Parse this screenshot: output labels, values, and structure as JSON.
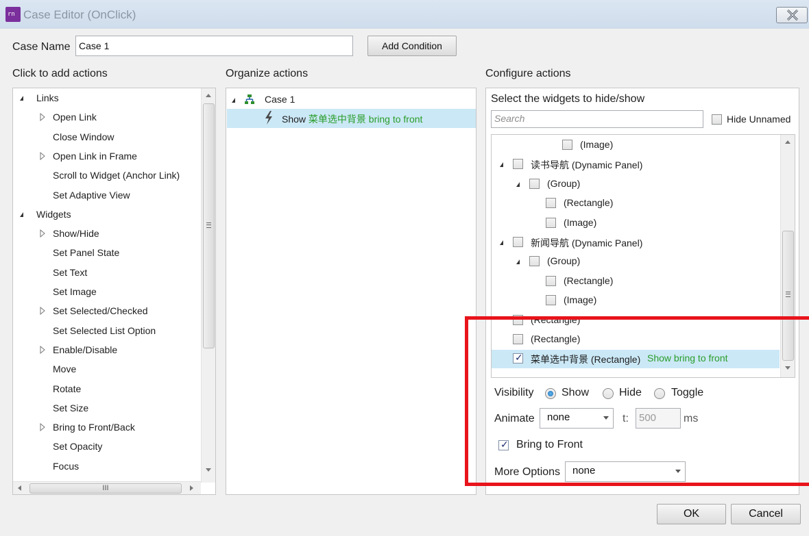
{
  "window": {
    "title": "Case Editor (OnClick)",
    "close_icon": "close-icon"
  },
  "case_name": {
    "label": "Case Name",
    "value": "Case 1",
    "add_condition": "Add Condition"
  },
  "left": {
    "heading": "Click to add actions",
    "items": [
      {
        "label": "Links",
        "level": 0,
        "exp": "open"
      },
      {
        "label": "Open Link",
        "level": 1,
        "exp": "closed"
      },
      {
        "label": "Close Window",
        "level": 1,
        "exp": "none"
      },
      {
        "label": "Open Link in Frame",
        "level": 1,
        "exp": "closed"
      },
      {
        "label": "Scroll to Widget (Anchor Link)",
        "level": 1,
        "exp": "none"
      },
      {
        "label": "Set Adaptive View",
        "level": 1,
        "exp": "none"
      },
      {
        "label": "Widgets",
        "level": 0,
        "exp": "open"
      },
      {
        "label": "Show/Hide",
        "level": 1,
        "exp": "closed"
      },
      {
        "label": "Set Panel State",
        "level": 1,
        "exp": "none"
      },
      {
        "label": "Set Text",
        "level": 1,
        "exp": "none"
      },
      {
        "label": "Set Image",
        "level": 1,
        "exp": "none"
      },
      {
        "label": "Set Selected/Checked",
        "level": 1,
        "exp": "closed"
      },
      {
        "label": "Set Selected List Option",
        "level": 1,
        "exp": "none"
      },
      {
        "label": "Enable/Disable",
        "level": 1,
        "exp": "closed"
      },
      {
        "label": "Move",
        "level": 1,
        "exp": "none"
      },
      {
        "label": "Rotate",
        "level": 1,
        "exp": "none"
      },
      {
        "label": "Set Size",
        "level": 1,
        "exp": "none"
      },
      {
        "label": "Bring to Front/Back",
        "level": 1,
        "exp": "closed"
      },
      {
        "label": "Set Opacity",
        "level": 1,
        "exp": "none"
      },
      {
        "label": "Focus",
        "level": 1,
        "exp": "none"
      }
    ],
    "hscroll_grip": "III"
  },
  "middle": {
    "heading": "Organize actions",
    "case_label": "Case 1",
    "action_verb": "Show",
    "action_detail": "菜单选中背景 bring to front"
  },
  "right": {
    "heading": "Configure actions",
    "subheading": "Select the widgets to hide/show",
    "search_placeholder": "Search",
    "hide_unnamed": "Hide Unnamed",
    "widgets": [
      {
        "label": "(Image)",
        "level": 3,
        "exp": "none",
        "checked": false
      },
      {
        "label": "读书导航 (Dynamic Panel)",
        "level": 0,
        "exp": "open",
        "checked": false
      },
      {
        "label": "(Group)",
        "level": 1,
        "exp": "open",
        "checked": false
      },
      {
        "label": "(Rectangle)",
        "level": 2,
        "exp": "none",
        "checked": false
      },
      {
        "label": "(Image)",
        "level": 2,
        "exp": "none",
        "checked": false
      },
      {
        "label": "新闻导航 (Dynamic Panel)",
        "level": 0,
        "exp": "open",
        "checked": false
      },
      {
        "label": "(Group)",
        "level": 1,
        "exp": "open",
        "checked": false
      },
      {
        "label": "(Rectangle)",
        "level": 2,
        "exp": "none",
        "checked": false
      },
      {
        "label": "(Image)",
        "level": 2,
        "exp": "none",
        "checked": false
      },
      {
        "label": "(Rectangle)",
        "level": 0,
        "exp": "none",
        "checked": false
      },
      {
        "label": "(Rectangle)",
        "level": 0,
        "exp": "none",
        "checked": false
      },
      {
        "label": "菜单选中背景 (Rectangle)",
        "level": 0,
        "exp": "none",
        "checked": true,
        "note": "Show bring to front"
      }
    ],
    "visibility": {
      "label": "Visibility",
      "options": [
        "Show",
        "Hide",
        "Toggle"
      ],
      "selected": "Show"
    },
    "animate": {
      "label": "Animate",
      "value": "none",
      "t_label": "t:",
      "t_value": "500",
      "unit": "ms"
    },
    "bring_to_front": {
      "label": "Bring to Front",
      "checked": true
    },
    "more_options": {
      "label": "More Options",
      "value": "none"
    }
  },
  "footer": {
    "ok": "OK",
    "cancel": "Cancel"
  },
  "colors": {
    "selection": "#cbe8f6",
    "highlight_box": "#e8141b",
    "green_text": "#2a9d2a"
  }
}
